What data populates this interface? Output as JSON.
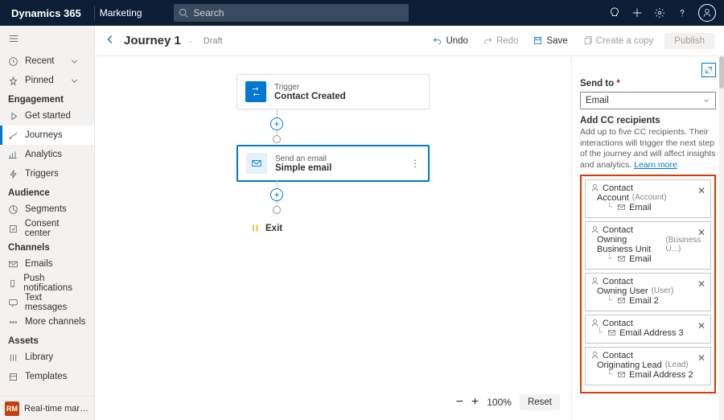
{
  "header": {
    "brand": "Dynamics 365",
    "area": "Marketing",
    "search_placeholder": "Search"
  },
  "sidebar": {
    "recent": "Recent",
    "pinned": "Pinned",
    "groups": [
      {
        "title": "Engagement",
        "items": [
          "Get started",
          "Journeys",
          "Analytics",
          "Triggers"
        ],
        "activeIndex": 1
      },
      {
        "title": "Audience",
        "items": [
          "Segments",
          "Consent center"
        ]
      },
      {
        "title": "Channels",
        "items": [
          "Emails",
          "Push notifications",
          "Text messages",
          "More channels"
        ]
      },
      {
        "title": "Assets",
        "items": [
          "Library",
          "Templates"
        ]
      }
    ],
    "area_badge": "RM",
    "area_label": "Real-time marketi..."
  },
  "cmdbar": {
    "title": "Journey 1",
    "status": "Draft",
    "undo": "Undo",
    "redo": "Redo",
    "save": "Save",
    "copy": "Create a copy",
    "publish": "Publish"
  },
  "canvas": {
    "trigger": {
      "label_sm": "Trigger",
      "label_lg": "Contact Created"
    },
    "email": {
      "label_sm": "Send an email",
      "label_lg": "Simple email"
    },
    "exit": "Exit",
    "zoom": {
      "pct": "100%",
      "reset": "Reset"
    }
  },
  "panel": {
    "sendto_label": "Send to",
    "sendto_value": "Email",
    "cc_title": "Add CC recipients",
    "cc_help": "Add up to five CC recipients. Their interactions will trigger the next step of the journey and will affect insights and analytics. ",
    "cc_learn": "Learn more",
    "cards": [
      {
        "top": "Contact",
        "mid": "Account",
        "mid_hint": "(Account)",
        "leaf": "Email"
      },
      {
        "top": "Contact",
        "mid": "Owning Business Unit",
        "mid_hint": "(Business U...)",
        "leaf": "Email"
      },
      {
        "top": "Contact",
        "mid": "Owning User",
        "mid_hint": "(User)",
        "leaf": "Email 2"
      },
      {
        "top": "Contact",
        "mid": "",
        "mid_hint": "",
        "leaf": "Email Address 3"
      },
      {
        "top": "Contact",
        "mid": "Originating Lead",
        "mid_hint": "(Lead)",
        "leaf": "Email Address 2"
      }
    ]
  }
}
